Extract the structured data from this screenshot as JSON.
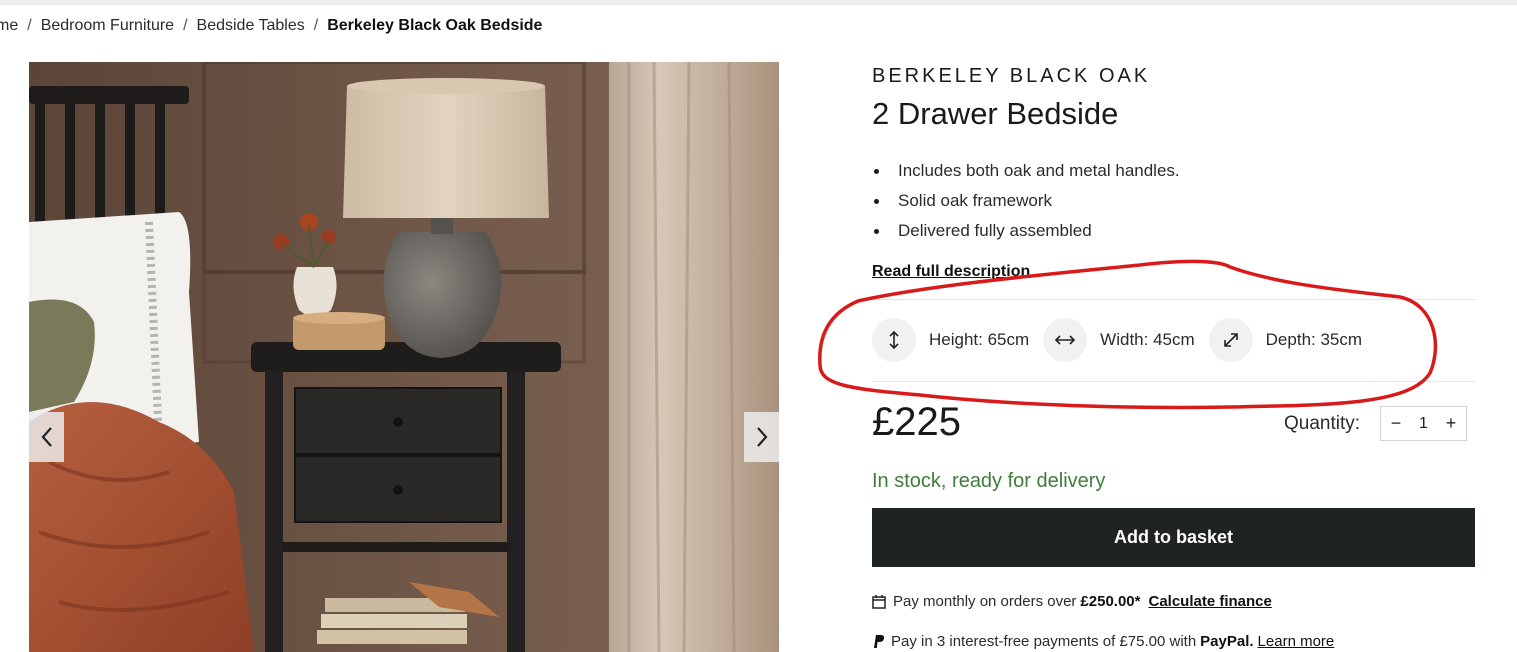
{
  "breadcrumb": {
    "items": [
      "me",
      "Bedroom Furniture",
      "Bedside Tables"
    ],
    "separator": "/",
    "current": "Berkeley Black Oak Bedside"
  },
  "gallery": {
    "prev_icon": "chevron-left-icon",
    "next_icon": "chevron-right-icon"
  },
  "product": {
    "brand": "BERKELEY BLACK OAK",
    "name": "2 Drawer Bedside",
    "features": [
      "Includes both oak and metal handles.",
      "Solid oak framework",
      "Delivered fully assembled"
    ],
    "read_more": "Read full description",
    "dimensions": [
      {
        "icon": "vertical-arrows-icon",
        "label": "Height: 65cm"
      },
      {
        "icon": "horizontal-arrows-icon",
        "label": "Width: 45cm"
      },
      {
        "icon": "diagonal-arrows-icon",
        "label": "Depth: 35cm"
      }
    ],
    "price": "£225",
    "quantity": {
      "label": "Quantity:",
      "value": "1",
      "minus": "−",
      "plus": "+"
    },
    "stock": "In stock, ready for delivery",
    "add_to_basket": "Add to basket"
  },
  "finance": {
    "icon": "calendar-icon",
    "text": "Pay monthly on orders over",
    "amount": "£250.00*",
    "link": "Calculate finance"
  },
  "paypal": {
    "icon": "paypal-icon",
    "text": "Pay in 3 interest-free payments of £75.00 with",
    "brand": "PayPal.",
    "link": "Learn more"
  },
  "colors": {
    "stock_green": "#3f7d3b",
    "button_dark": "#1f2420",
    "annotation_red": "#d91a1a"
  }
}
